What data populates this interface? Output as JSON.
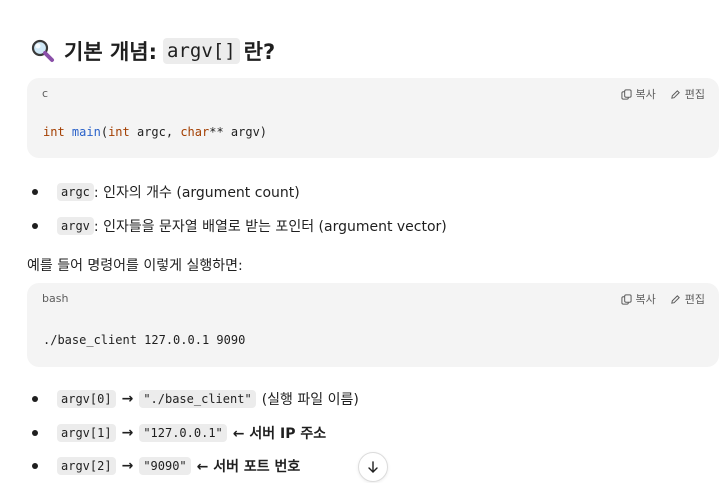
{
  "heading": {
    "emoji": "🔍",
    "text_before": "기본 개념:",
    "code": "argv[]",
    "text_after": "란?"
  },
  "code_block_1": {
    "language": "c",
    "copy_label": "복사",
    "edit_label": "편집",
    "tokens": [
      "int",
      " ",
      "main",
      "(",
      "int",
      " argc, ",
      "char",
      "** argv)"
    ]
  },
  "bullets_1": [
    {
      "code": "argc",
      "text": ": 인자의 개수 (argument count)"
    },
    {
      "code": "argv",
      "text": ": 인자들을 문자열 배열로 받는 포인터 (argument vector)"
    }
  ],
  "paragraph": "예를 들어 명령어를 이렇게 실행하면:",
  "code_block_2": {
    "language": "bash",
    "copy_label": "복사",
    "edit_label": "편집",
    "code": "./base_client 127.0.0.1 9090"
  },
  "bullets_2": [
    {
      "code": "argv[0]",
      "arrow": "→",
      "value": "\"./base_client\"",
      "note": "(실행 파일 이름)",
      "note_bold": false
    },
    {
      "code": "argv[1]",
      "arrow": "→",
      "value": "\"127.0.0.1\"",
      "note": "← 서버 IP 주소",
      "note_bold": true
    },
    {
      "code": "argv[2]",
      "arrow": "→",
      "value": "\"9090\"",
      "note": "← 서버 포트 번호",
      "note_bold": true
    }
  ],
  "colors": {
    "keyword": "#a33e00",
    "function": "#2a62c9",
    "code_bg": "#f4f4f4",
    "pill_bg": "#ececec"
  },
  "icons": {
    "copy": "copy-icon",
    "edit": "pencil-icon",
    "scroll": "arrow-down-icon",
    "heading": "magnifier-icon"
  }
}
